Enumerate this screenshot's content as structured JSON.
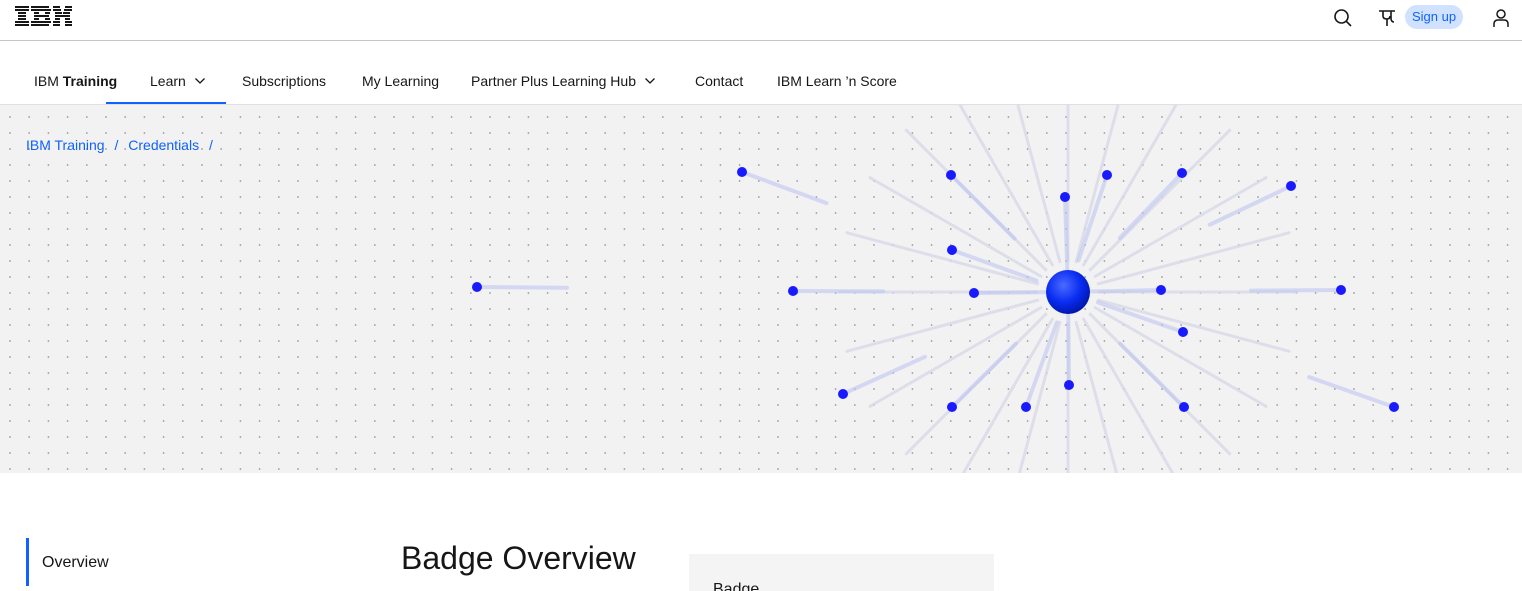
{
  "masthead": {
    "logo_text": "IBM",
    "signup_label": "Sign up",
    "icons": [
      "search-icon",
      "language-icon",
      "user-icon"
    ]
  },
  "nav": {
    "brand_prefix": "IBM",
    "brand_bold": "Training",
    "items": [
      {
        "label": "Learn",
        "has_menu": true,
        "active": true
      },
      {
        "label": "Subscriptions"
      },
      {
        "label": "My Learning"
      },
      {
        "label": "Partner Plus Learning Hub",
        "has_menu": true
      },
      {
        "label": "Contact"
      },
      {
        "label": "IBM Learn ’n Score"
      }
    ]
  },
  "breadcrumb": {
    "items": [
      "IBM Training",
      "Credentials"
    ],
    "separator": "/"
  },
  "side_nav": {
    "items": [
      {
        "label": "Overview",
        "active": true
      }
    ]
  },
  "main": {
    "title": "Badge Overview",
    "card_label": "Badge"
  },
  "colors": {
    "accent": "#0f62fe",
    "hero_bg": "#f2f2f2",
    "dot": "#1a1aff"
  }
}
